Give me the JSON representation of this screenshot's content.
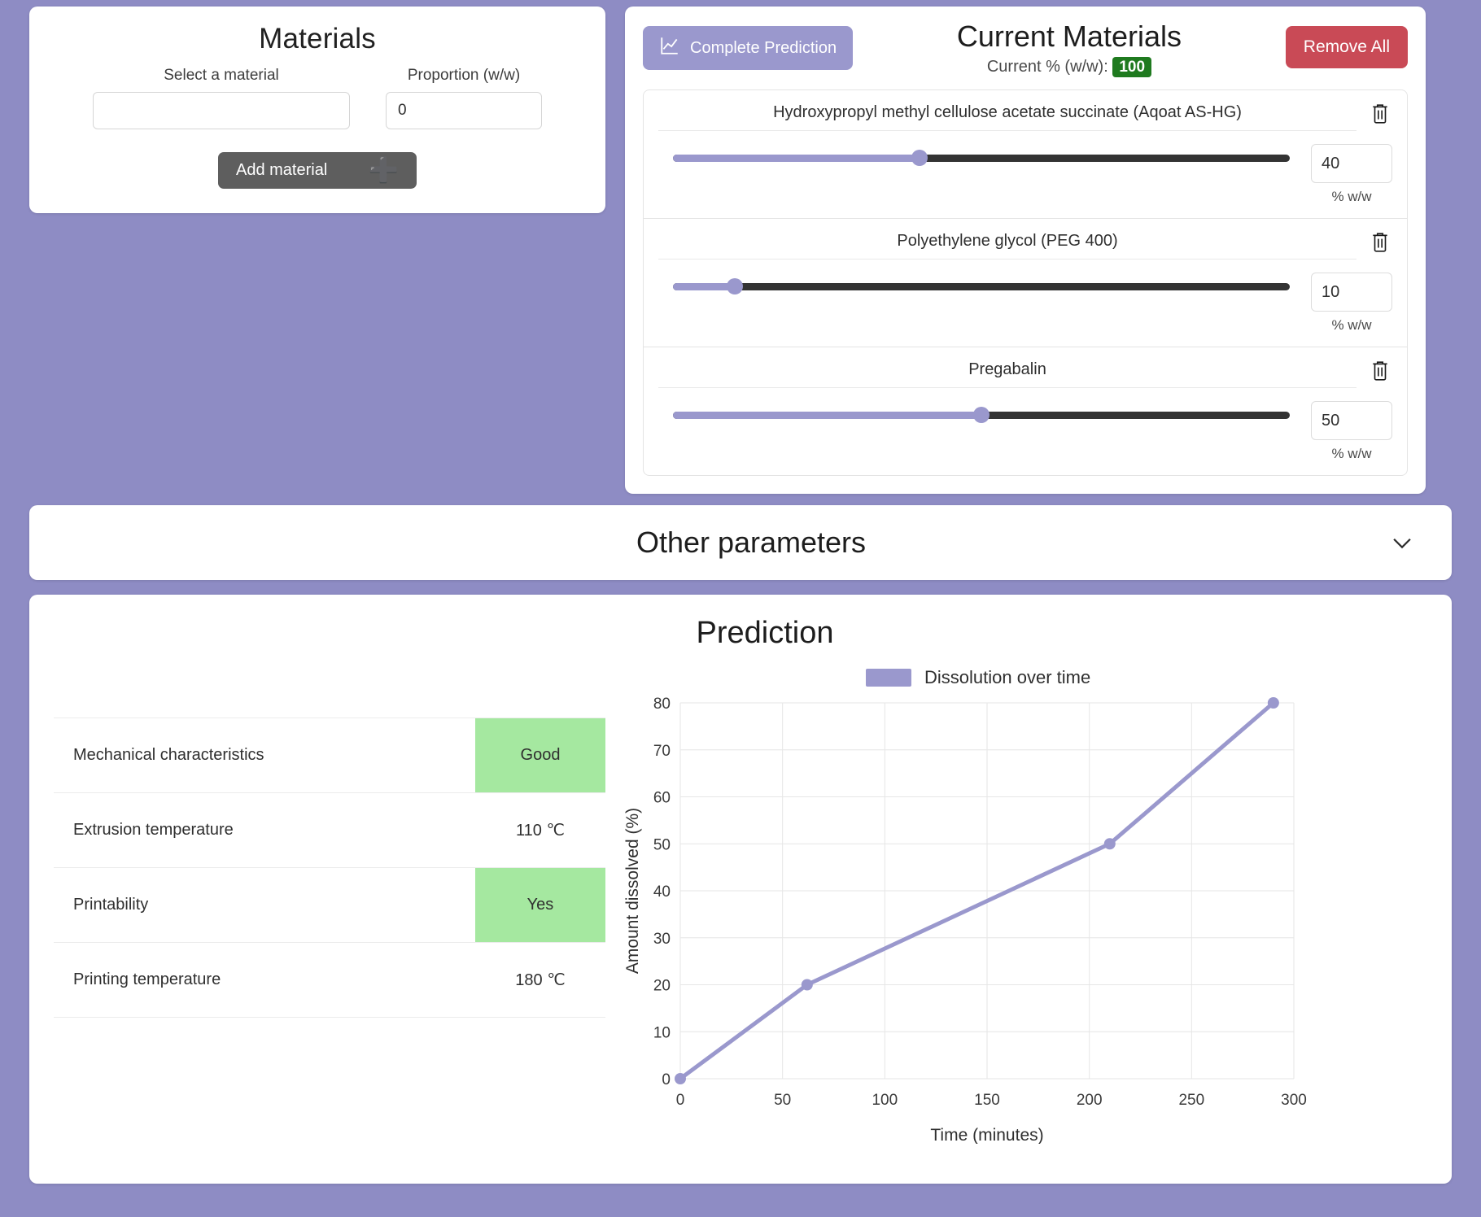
{
  "materials_panel": {
    "title": "Materials",
    "select_label": "Select a material",
    "select_value": "",
    "select_placeholder": "",
    "proportion_label": "Proportion (w/w)",
    "proportion_value": "0",
    "add_button": "Add material",
    "add_icon": "plus-icon"
  },
  "current_panel": {
    "complete_button": "Complete Prediction",
    "complete_icon": "line-chart-icon",
    "title": "Current Materials",
    "subtitle_label": "Current % (w/w):",
    "subtitle_value": "100",
    "badge_color": "#1f7a1f",
    "remove_all_button": "Remove All",
    "remove_all_color": "#c94a56",
    "unit": "% w/w",
    "delete_icon": "trash-icon",
    "materials": [
      {
        "name": "Hydroxypropyl methyl cellulose acetate succinate (Aqoat AS-HG)",
        "value": "40"
      },
      {
        "name": "Polyethylene glycol (PEG 400)",
        "value": "10"
      },
      {
        "name": "Pregabalin",
        "value": "50"
      }
    ]
  },
  "other_parameters": {
    "title": "Other parameters",
    "chevron_icon": "chevron-down-icon"
  },
  "prediction": {
    "title": "Prediction",
    "rows": [
      {
        "label": "Mechanical characteristics",
        "value": "Good",
        "highlight": true
      },
      {
        "label": "Extrusion temperature",
        "value": "110 ℃",
        "highlight": false
      },
      {
        "label": "Printability",
        "value": "Yes",
        "highlight": true
      },
      {
        "label": "Printing temperature",
        "value": "180 ℃",
        "highlight": false
      }
    ],
    "highlight_color": "#a5e8a0"
  },
  "chart_data": {
    "type": "line",
    "title": "",
    "xlabel": "Time (minutes)",
    "ylabel": "Amount dissolved (%)",
    "legend": [
      "Dissolution over time"
    ],
    "legend_position": "top",
    "series_color": "#9a98cd",
    "grid": true,
    "xlim": [
      0,
      300
    ],
    "ylim": [
      0,
      80
    ],
    "xticks": [
      0,
      50,
      100,
      150,
      200,
      250,
      300
    ],
    "yticks": [
      0,
      10,
      20,
      30,
      40,
      50,
      60,
      70,
      80
    ],
    "series": [
      {
        "name": "Dissolution over time",
        "x": [
          0,
          62,
          210,
          290
        ],
        "y": [
          0,
          20,
          50,
          80
        ]
      }
    ]
  }
}
